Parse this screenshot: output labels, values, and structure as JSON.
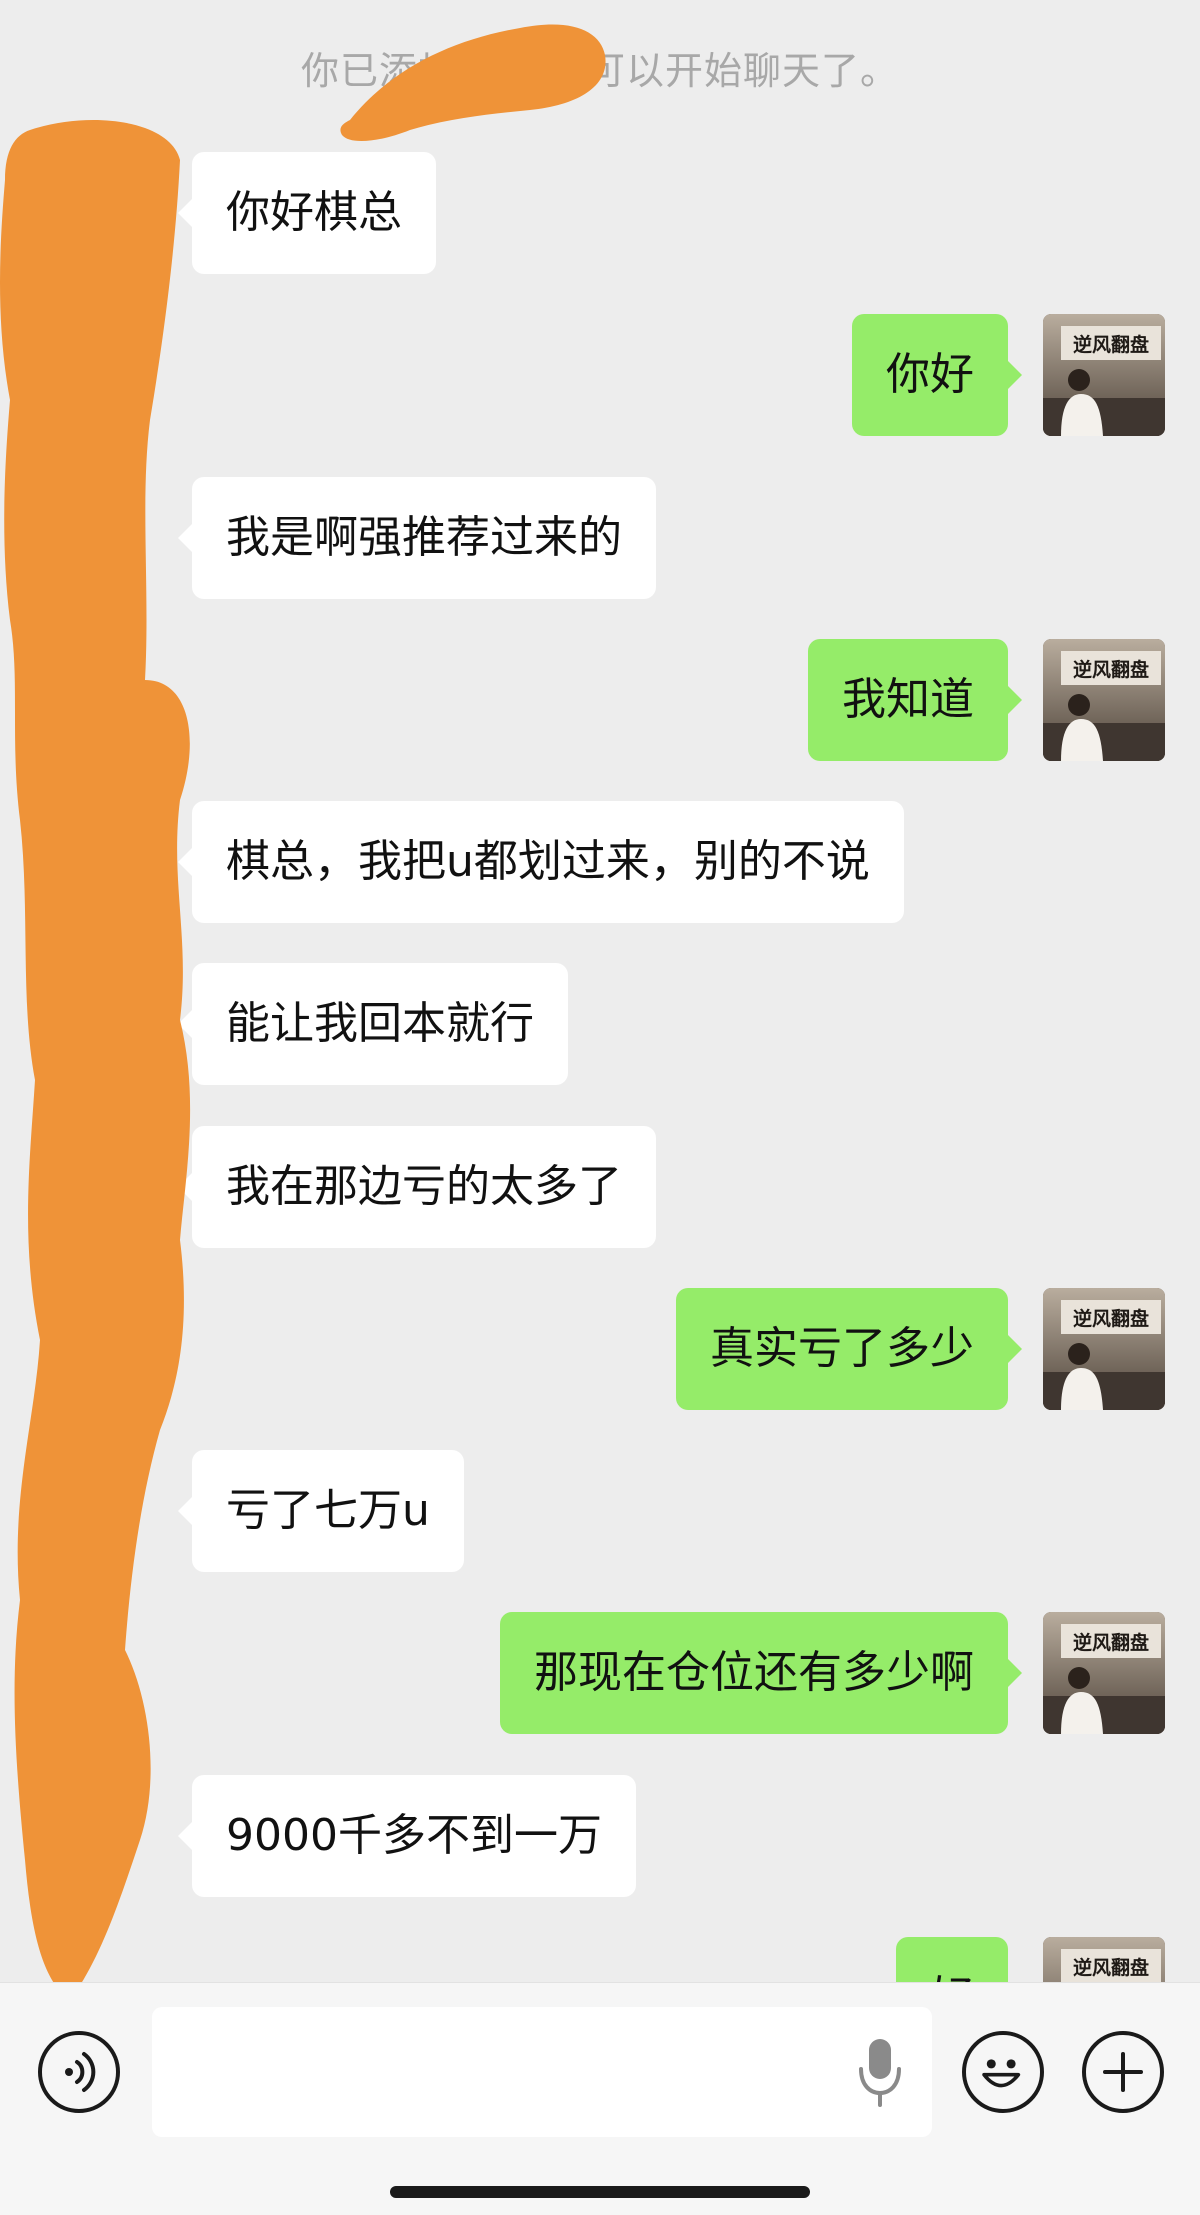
{
  "system_notice": "你已添加了 现在可以开始聊天了。",
  "messages": [
    {
      "side": "in",
      "text": "你好棋总"
    },
    {
      "side": "out",
      "text": "你好"
    },
    {
      "side": "in",
      "text": "我是啊强推荐过来的"
    },
    {
      "side": "out",
      "text": "我知道"
    },
    {
      "side": "in",
      "text": "棋总，我把u都划过来，别的不说"
    },
    {
      "side": "in",
      "text": "能让我回本就行"
    },
    {
      "side": "in",
      "text": "我在那边亏的太多了"
    },
    {
      "side": "out",
      "text": "真实亏了多少"
    },
    {
      "side": "in",
      "text": "亏了七万u"
    },
    {
      "side": "out",
      "text": "那现在仓位还有多少啊"
    },
    {
      "side": "in",
      "text": "9000千多不到一万"
    },
    {
      "side": "out",
      "text": "好"
    }
  ],
  "avatar_sign_text": "逆风翻盘",
  "input_bar": {
    "placeholder": "",
    "value": "",
    "icons": [
      "voice-icon",
      "microphone-icon",
      "emoji-icon",
      "plus-icon"
    ]
  },
  "colors": {
    "background": "#ededed",
    "outgoing_bubble": "#95ec69",
    "incoming_bubble": "#ffffff",
    "redaction": "#ef9338"
  }
}
